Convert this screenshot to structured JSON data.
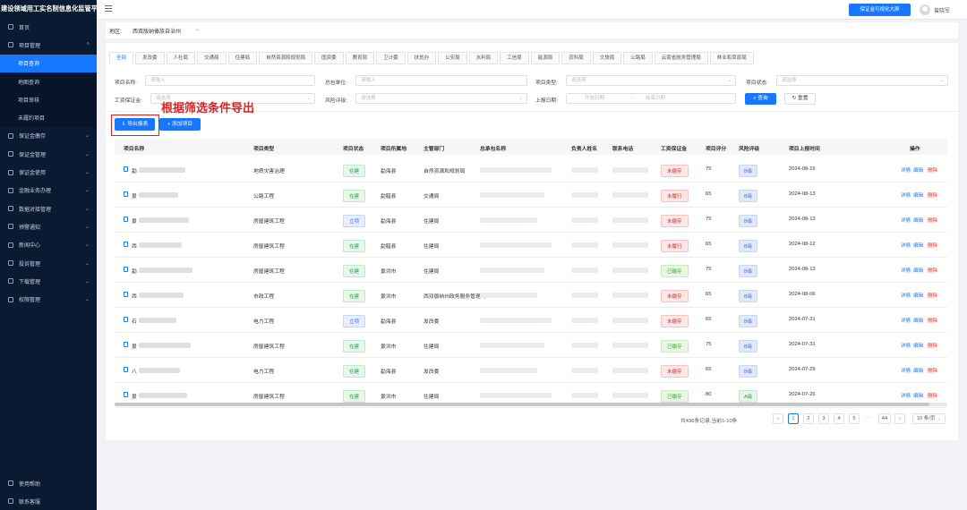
{
  "app": {
    "title": "建设领域用工实名制信息化监管平台"
  },
  "sidebar": {
    "items": [
      {
        "label": "首页",
        "icon": "home-icon"
      },
      {
        "label": "项目管理",
        "icon": "folder-icon",
        "expanded": true
      }
    ],
    "subitems": [
      {
        "label": "项目查询",
        "active": true
      },
      {
        "label": "地图查询"
      },
      {
        "label": "项目审核"
      },
      {
        "label": "未履约项目"
      }
    ],
    "items_after": [
      {
        "label": "保证金缴存",
        "icon": "deposit-icon"
      },
      {
        "label": "保证金管理",
        "icon": "wallet-icon"
      },
      {
        "label": "保证金使用",
        "icon": "money-icon"
      },
      {
        "label": "金融业务办理",
        "icon": "bank-icon"
      },
      {
        "label": "数据对接管理",
        "icon": "link-icon"
      },
      {
        "label": "预警通知",
        "icon": "bell-icon"
      },
      {
        "label": "新闻中心",
        "icon": "news-icon"
      },
      {
        "label": "投诉管理",
        "icon": "complaint-icon"
      },
      {
        "label": "下载管理",
        "icon": "download-icon"
      },
      {
        "label": "权限管理",
        "icon": "lock-icon"
      }
    ],
    "bottom": [
      {
        "label": "使用帮助",
        "icon": "help-icon"
      },
      {
        "label": "联系客服",
        "icon": "service-icon"
      }
    ]
  },
  "topbar": {
    "bigscreen_button": "保证金可视化大屏",
    "username": "曾晓军"
  },
  "region": {
    "label": "地区:",
    "value": "西双版纳傣族自治州"
  },
  "tabs": [
    "全部",
    "发改委",
    "人社局",
    "交通局",
    "住建局",
    "自然资源和规划局",
    "国资委",
    "教育局",
    "卫计委",
    "扶贫办",
    "公安局",
    "水利局",
    "工信局",
    "能源局",
    "农科局",
    "文旅局",
    "公路局",
    "云南省航务管理局",
    "林业和草原局"
  ],
  "filters": {
    "project_name": {
      "label": "项目名称:",
      "placeholder": "请输入"
    },
    "contractor": {
      "label": "总包单位:",
      "placeholder": "请输入"
    },
    "project_type": {
      "label": "项目类型:",
      "placeholder": "请选择"
    },
    "project_status": {
      "label": "项目状态:",
      "placeholder": "请选择"
    },
    "wage_deposit": {
      "label": "工资保证金:",
      "placeholder": "请选择"
    },
    "risk_level": {
      "label": "风险评级:",
      "placeholder": "请选择"
    },
    "report_date": {
      "label": "上报日期:",
      "start_placeholder": "开始日期",
      "separator": "-",
      "end_placeholder": "结束日期"
    },
    "search_button": "查询",
    "reset_button": "重置"
  },
  "actions": {
    "export_button": "导出报表",
    "add_button": "添加项目",
    "annotation": "根据筛选条件导出"
  },
  "table": {
    "columns": [
      "项目名称",
      "项目类型",
      "项目状态",
      "项目所属地",
      "主管部门",
      "总承包名称",
      "负责人姓名",
      "联系电话",
      "工资保证金",
      "项目评分",
      "风险评级",
      "项目上报时间",
      "操作"
    ],
    "rows": [
      {
        "initial": "勐",
        "type": "地质灾害治理",
        "status": "在建",
        "status_color": "green",
        "location": "勐海县",
        "department": "自然资源和规划局",
        "deposit": "未缴存",
        "deposit_color": "red",
        "score": "75",
        "risk": "B级",
        "risk_color": "blue",
        "date": "2024-08-15",
        "ops": [
          "详情",
          "编辑",
          "删除"
        ]
      },
      {
        "initial": "景",
        "type": "公路工程",
        "status": "在建",
        "status_color": "green",
        "location": "勐腊县",
        "department": "交通局",
        "deposit": "未履行",
        "deposit_color": "red",
        "score": "65",
        "risk": "B级",
        "risk_color": "blue",
        "date": "2024-08-13",
        "ops": [
          "详情",
          "编辑",
          "删除"
        ]
      },
      {
        "initial": "景",
        "type": "房屋建筑工程",
        "status": "立项",
        "status_color": "blue",
        "location": "勐海县",
        "department": "住建局",
        "deposit": "未缴存",
        "deposit_color": "red",
        "score": "75",
        "risk": "B级",
        "risk_color": "blue",
        "date": "2024-08-13",
        "ops": [
          "详情",
          "编辑",
          "删除"
        ]
      },
      {
        "initial": "西",
        "type": "房屋建筑工程",
        "status": "在建",
        "status_color": "green",
        "location": "勐腊县",
        "department": "住建局",
        "deposit": "未履行",
        "deposit_color": "red",
        "score": "65",
        "risk": "B级",
        "risk_color": "blue",
        "date": "2024-08-12",
        "ops": [
          "详情",
          "编辑",
          "删除"
        ]
      },
      {
        "initial": "勐",
        "type": "房屋建筑工程",
        "status": "在建",
        "status_color": "green",
        "location": "景洪市",
        "department": "住建局",
        "deposit": "已缴存",
        "deposit_color": "yellow",
        "score": "75",
        "risk": "B级",
        "risk_color": "blue",
        "date": "2024-08-13",
        "ops": [
          "详情",
          "编辑",
          "删除"
        ]
      },
      {
        "initial": "西",
        "type": "市政工程",
        "status": "在建",
        "status_color": "green",
        "location": "景洪市",
        "department": "西双版纳州政务服务管理局",
        "deposit": "未缴存",
        "deposit_color": "red",
        "score": "65",
        "risk": "B级",
        "risk_color": "blue",
        "date": "2024-08-06",
        "ops": [
          "详情",
          "编辑",
          "删除"
        ]
      },
      {
        "initial": "石",
        "type": "电力工程",
        "status": "立项",
        "status_color": "blue",
        "location": "勐海县",
        "department": "发改委",
        "deposit": "未缴存",
        "deposit_color": "red",
        "score": "65",
        "risk": "B级",
        "risk_color": "blue",
        "date": "2024-07-31",
        "ops": [
          "详情",
          "编辑",
          "删除"
        ]
      },
      {
        "initial": "景",
        "type": "房屋建筑工程",
        "status": "在建",
        "status_color": "green",
        "location": "景洪市",
        "department": "住建局",
        "deposit": "已缴存",
        "deposit_color": "yellow",
        "score": "75",
        "risk": "B级",
        "risk_color": "blue",
        "date": "2024-07-31",
        "ops": [
          "详情",
          "编辑",
          "删除"
        ]
      },
      {
        "initial": "八",
        "type": "电力工程",
        "status": "在建",
        "status_color": "green",
        "location": "勐海县",
        "department": "发改委",
        "deposit": "未缴存",
        "deposit_color": "red",
        "score": "65",
        "risk": "B级",
        "risk_color": "blue",
        "date": "2024-07-29",
        "ops": [
          "详情",
          "编辑",
          "删除"
        ]
      },
      {
        "initial": "景",
        "type": "房屋建筑工程",
        "status": "在建",
        "status_color": "green",
        "location": "景洪市",
        "department": "住建局",
        "deposit": "已缴存",
        "deposit_color": "yellow",
        "score": "80",
        "risk": "A级",
        "risk_color": "green",
        "date": "2024-07-26",
        "ops": [
          "详情",
          "编辑",
          "删除"
        ]
      }
    ]
  },
  "pagination": {
    "total_text": "共436条记录,当前1-10条",
    "pages": [
      "1",
      "2",
      "3",
      "4",
      "5"
    ],
    "ellipsis": "···",
    "last_page": "44",
    "page_size": "10 条/页",
    "prev": "‹",
    "next": "›"
  }
}
